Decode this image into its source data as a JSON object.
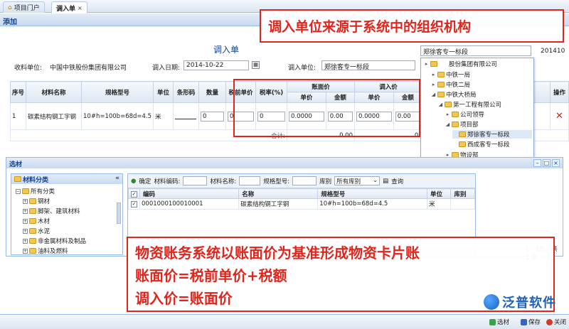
{
  "tabs": [
    {
      "label": "项目门户",
      "icon": "home-icon"
    },
    {
      "label": "调入单",
      "close": "×"
    }
  ],
  "add_header": "添加",
  "form": {
    "title": "调入单",
    "receiver_label": "收料单位:",
    "receiver_value": "中国中铁股份集团有限公司",
    "date_label": "调入日期:",
    "date_value": "2014-10-22",
    "in_unit_label": "调入单位:",
    "in_unit_value": "郑徐客专一标段",
    "dropdown_value": "郑徐客专一标段",
    "code_partial": "201410"
  },
  "grid": {
    "headers": {
      "seq": "序号",
      "name": "材料名称",
      "spec": "规格型号",
      "unit": "单位",
      "barcode": "条形码",
      "qty": "数量",
      "pretax": "税前单价",
      "taxrate": "税率(%)",
      "book_price": "账面价",
      "in_price": "调入价",
      "op": "操作",
      "unit_price": "单价",
      "amount": "金额"
    },
    "row": {
      "seq": "1",
      "name": "碳素结构钢工字钢",
      "spec": "10#h=100b=68d=4.5",
      "unit": "米",
      "qty": "0",
      "pretax": "0",
      "taxrate": "0",
      "book_unit": "0.0000",
      "book_amount": "0.00",
      "in_unit": "0.0000",
      "in_amount": "0.00"
    },
    "total_label": "合计:",
    "total_book": "0.00",
    "total_in": "0."
  },
  "callouts": {
    "top": "调入单位来源于系统中的组织机构",
    "bottom_line1": "物资账务系统以账面价为基准形成物资卡片账",
    "bottom_line2": "账面价=税前单价+税额",
    "bottom_line3": "调入价=账面价"
  },
  "tree": [
    {
      "label": "股份集团有限公司",
      "toggle": "▸"
    },
    {
      "label": "中铁一局",
      "toggle": "▸"
    },
    {
      "label": "中铁二局",
      "toggle": "▸"
    },
    {
      "label": "中铁大桥局",
      "toggle": "◢"
    },
    {
      "label": "第一工程有限公司",
      "toggle": "◢"
    },
    {
      "label": "公司领导",
      "toggle": "▸"
    },
    {
      "label": "项目部",
      "toggle": "◢"
    },
    {
      "label": "郑徐客专一标段",
      "toggle": ""
    },
    {
      "label": "西成客专一标段",
      "toggle": ""
    },
    {
      "label": "物设部",
      "toggle": "▸"
    }
  ],
  "select_section": {
    "title": "选材",
    "category_title": "材料分类",
    "collapse": "«",
    "categories": [
      "所有分类",
      "钢材",
      "脚架、建筑材料",
      "木材",
      "水泥",
      "非金属材料及制品",
      "油料及燃料"
    ],
    "toolbar": {
      "confirm": "确定",
      "code_label": "材料编码:",
      "name_label": "材料名称:",
      "spec_label": "规格型号:",
      "warehouse_label": "库别",
      "warehouse_value": "所有库别",
      "query": "查询"
    },
    "columns": [
      "编码",
      "名称",
      "规格型号",
      "单位",
      "库别"
    ],
    "rows": [
      {
        "code": "0001000100010001",
        "name": "碳素结构钢工字钢",
        "spec": "10#h=100b=68d=4.5",
        "unit": "米",
        "warehouse": ""
      }
    ],
    "paging": "1 - 1条，共 1 条"
  },
  "bottom_buttons": {
    "select": "选材",
    "save": "保存",
    "close": "关闭"
  },
  "logo": {
    "text": "泛普软件"
  },
  "colors": {
    "red": "#e0261c",
    "header_blue": "#15428b"
  }
}
